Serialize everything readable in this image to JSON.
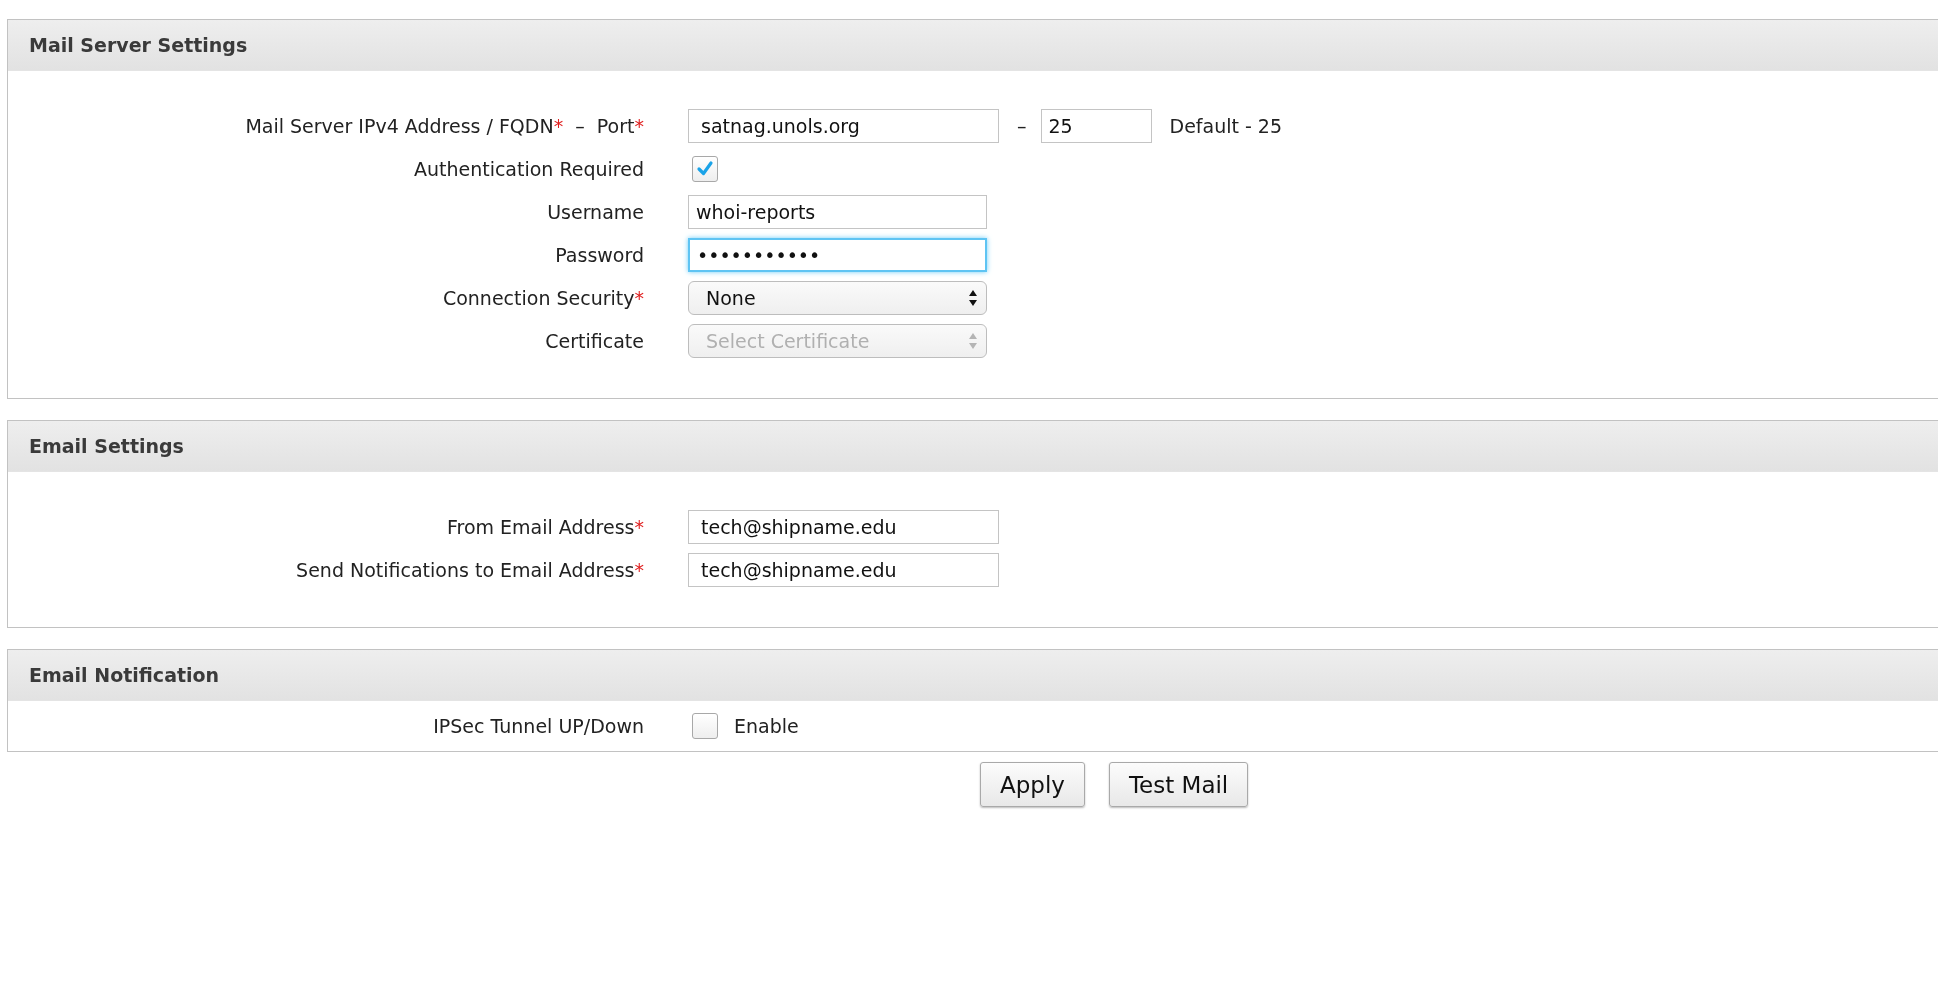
{
  "sections": [
    {
      "title": "Mail Server Settings",
      "kind": "settings",
      "rows": [
        {
          "kind": "server_port",
          "label": [
            {
              "text": "Mail Server IPv4 Address / FQDN",
              "kind": "plain"
            },
            {
              "text": "*",
              "kind": "required"
            },
            {
              "text": "  –  Port",
              "kind": "plain"
            },
            {
              "text": "*",
              "kind": "required"
            }
          ],
          "value": "satnag.unols.org",
          "separator": "–",
          "port": "25",
          "hint": "Default - 25"
        },
        {
          "kind": "checkbox",
          "label": [
            {
              "text": "Authentication Required",
              "kind": "plain"
            }
          ],
          "checked": true
        },
        {
          "kind": "text",
          "label": [
            {
              "text": "Username",
              "kind": "plain"
            }
          ],
          "value": "whoi-reports",
          "focused": false
        },
        {
          "kind": "text",
          "label": [
            {
              "text": "Password",
              "kind": "plain"
            }
          ],
          "value": "•••••••••••",
          "focused": true
        },
        {
          "kind": "select",
          "label": [
            {
              "text": "Connection Security",
              "kind": "plain"
            },
            {
              "text": "*",
              "kind": "required"
            }
          ],
          "value": "None",
          "disabled": false
        },
        {
          "kind": "select",
          "label": [
            {
              "text": "Certificate",
              "kind": "plain"
            }
          ],
          "value": "Select Certificate",
          "disabled": true
        }
      ]
    },
    {
      "title": "Email Settings",
      "kind": "settings",
      "rows": [
        {
          "kind": "wide_text",
          "label": [
            {
              "text": "From Email Address",
              "kind": "plain"
            },
            {
              "text": "*",
              "kind": "required"
            }
          ],
          "value": "tech@shipname.edu",
          "focused": false
        },
        {
          "kind": "wide_text",
          "label": [
            {
              "text": "Send Notifications to Email Address",
              "kind": "plain"
            },
            {
              "text": "*",
              "kind": "required"
            }
          ],
          "value": "tech@shipname.edu",
          "focused": false
        }
      ]
    },
    {
      "title": "Email Notification",
      "kind": "compact",
      "rows": [
        {
          "kind": "checkbox",
          "label": [
            {
              "text": "IPSec Tunnel UP/Down",
              "kind": "plain"
            }
          ],
          "checked": false,
          "text": "Enable"
        }
      ]
    }
  ],
  "buttons": [
    {
      "label": "Apply"
    },
    {
      "label": "Test Mail"
    }
  ]
}
